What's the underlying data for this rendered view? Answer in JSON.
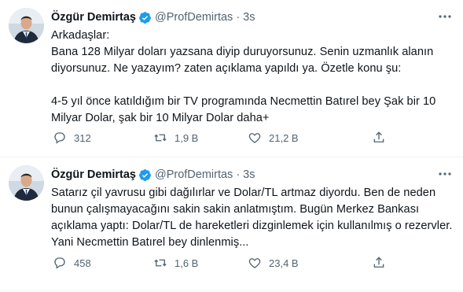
{
  "tweets": [
    {
      "author": {
        "name": "Özgür Demirtaş",
        "handle": "@ProfDemirtas",
        "time": "3s"
      },
      "separator": "·",
      "text": "Arkadaşlar:\nBana 128 Milyar doları yazsana diyip duruyorsunuz. Senin uzmanlık alanın diyorsunuz. Ne yazayım? zaten açıklama yapıldı ya. Özetle konu şu:\n\n4-5 yıl önce katıldığım bir TV programında Necmettin Batırel bey Şak bir 10 Milyar Dolar, şak bir 10 Milyar Dolar daha+",
      "stats": {
        "replies": "312",
        "retweets": "1,9 B",
        "likes": "21,2 B"
      }
    },
    {
      "author": {
        "name": "Özgür Demirtaş",
        "handle": "@ProfDemirtas",
        "time": "3s"
      },
      "separator": "·",
      "text": "Satarız çil yavrusu gibi dağılırlar ve Dolar/TL artmaz diyordu. Ben de neden bunun çalışmayacağını sakin sakin anlatmıştım. Bugün Merkez Bankası açıklama yaptı: Dolar/TL de hareketleri dizginlemek için kullanılmış o rezervler. Yani Necmettin Batırel bey dinlenmiş...",
      "stats": {
        "replies": "458",
        "retweets": "1,6 B",
        "likes": "23,4 B"
      }
    }
  ],
  "icons": {
    "verified": "verified-badge-icon",
    "reply": "reply-icon",
    "retweet": "retweet-icon",
    "like": "heart-icon",
    "share": "share-icon",
    "more": "more-options-icon"
  },
  "colors": {
    "verified": "#1d9bf0",
    "text": "#0f1419",
    "secondary": "#536471",
    "divider": "#eff3f4"
  }
}
